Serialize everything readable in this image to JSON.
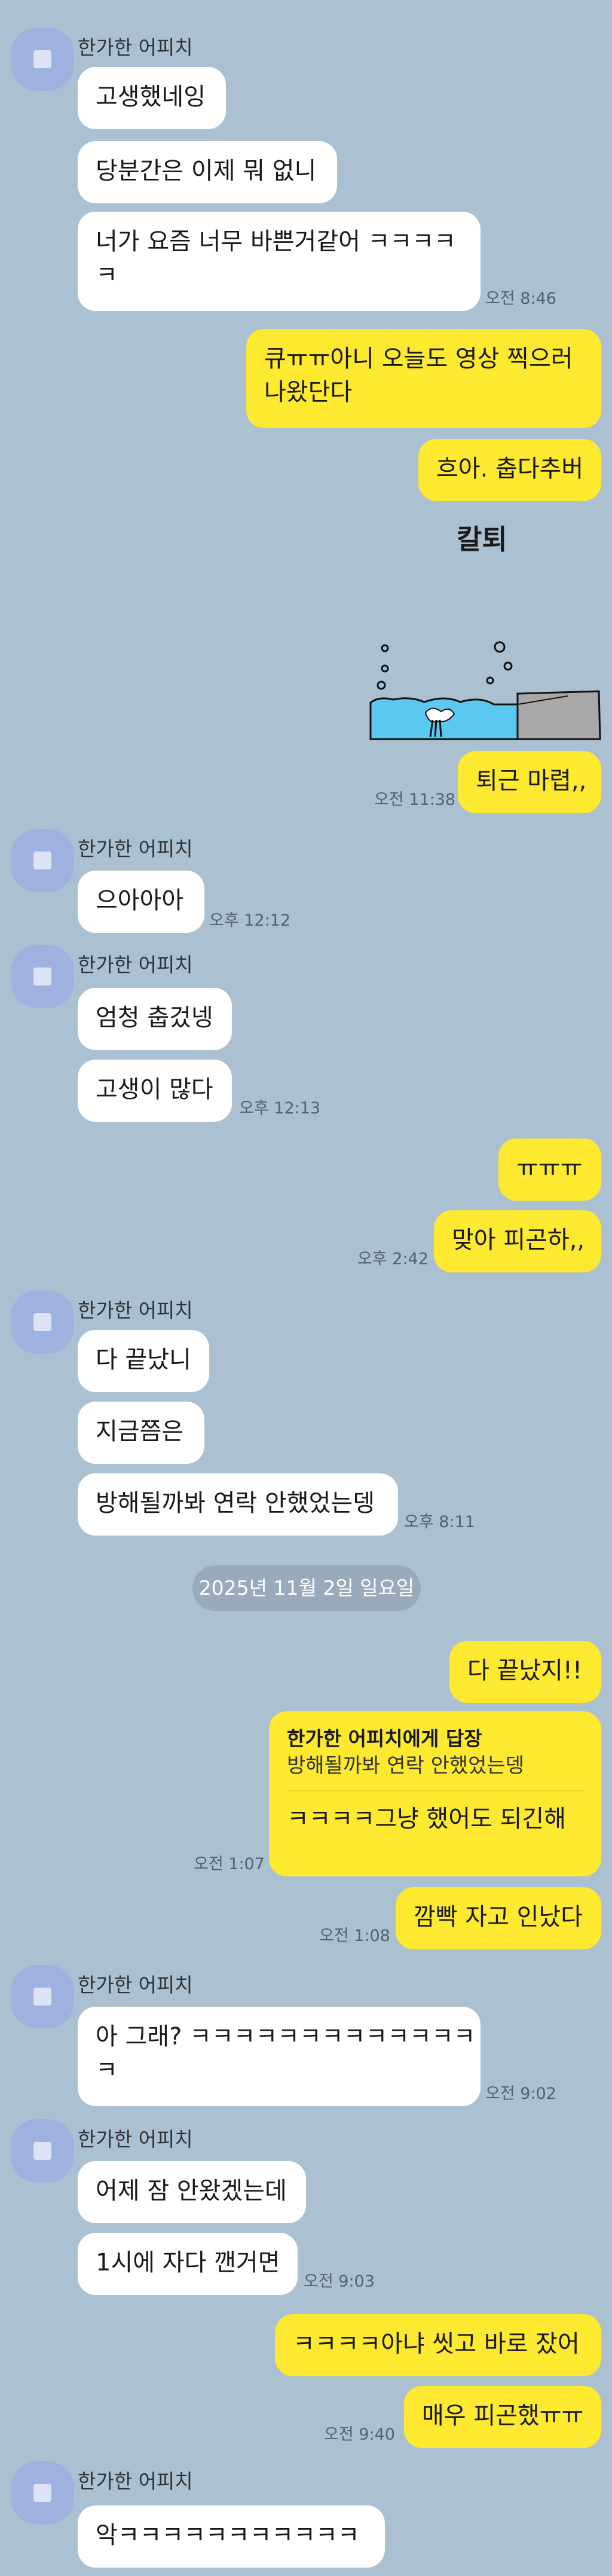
{
  "contact_name": "한가한 어피치",
  "date_divider": "2025년 11월 2일 일요일",
  "messages": {
    "m1": "고생했네잉",
    "m2": "당분간은 이제 뭐 없니",
    "m3a": "너가 요즘 너무 바쁜거같어 ㅋㅋㅋㅋ",
    "m3b": "ㅋ",
    "t1": "오전 8:46",
    "m4a": "큐ㅠㅠ아니 오늘도 영상 찍으러",
    "m4b": "나왔단다",
    "m5": "흐아. 춥다추버",
    "sticker_caption": "칼퇴",
    "m6": "퇴근 마렵,,",
    "t2": "오전 11:38",
    "m7": "으아아아",
    "t3": "오후 12:12",
    "m8": "엄청 춥겄넹",
    "m9": "고생이 많다",
    "t4": "오후 12:13",
    "m10": "ㅠㅠㅠ",
    "m11": "맞아 피곤하,,",
    "t5": "오후 2:42",
    "m12": "다 끝났니",
    "m13": "지금쯤은",
    "m14": "방해될까봐 연락 안했었는뎅",
    "t6": "오후 8:11",
    "m15": "다 끝났지!!",
    "reply_label": "한가한 어피치에게 답장",
    "reply_quote": "방해될까봐 연락 안했었는뎅",
    "reply_text": "ㅋㅋㅋㅋ그냥 했어도 되긴해",
    "t7": "오전 1:07",
    "m16": "깜빡 자고 인났다",
    "t8": "오전 1:08",
    "m17a": "아 그래? ㅋㅋㅋㅋㅋㅋㅋㅋㅋㅋㅋㅋㅋ",
    "m17b": "ㅋ",
    "t9": "오전 9:02",
    "m18": "어제 잠 안왔겠는데",
    "m19": "1시에 자다 깬거면",
    "t10": "오전 9:03",
    "m20": "ㅋㅋㅋㅋ아냐 씻고 바로 잤어",
    "m21": "매우 피곤했ㅠㅠ",
    "t11": "오전 9:40",
    "m22": "악ㅋㅋㅋㅋㅋㅋㅋㅋㅋㅋㅋ"
  },
  "colors": {
    "background": "#abc1d1",
    "my_bubble": "#fde92f",
    "their_bubble": "#ffffff",
    "avatar": "#9fb1de"
  }
}
